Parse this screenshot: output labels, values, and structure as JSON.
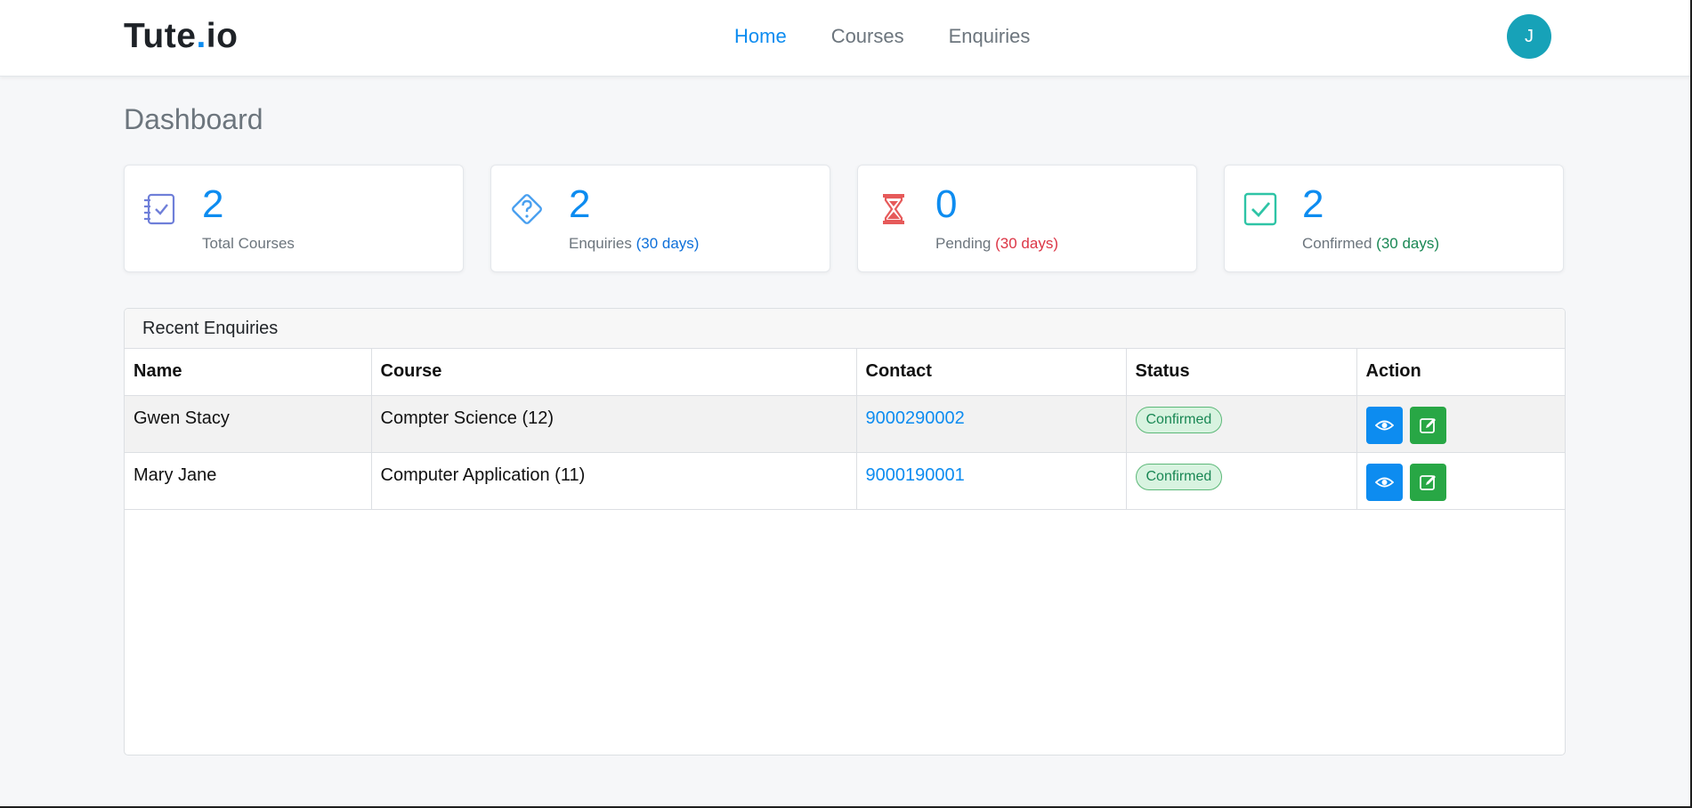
{
  "brand": {
    "name": "Tute",
    "dot": ".",
    "suffix": "io"
  },
  "nav": {
    "links": [
      {
        "label": "Home",
        "active": true
      },
      {
        "label": "Courses",
        "active": false
      },
      {
        "label": "Enquiries",
        "active": false
      }
    ],
    "avatar_initial": "J"
  },
  "page": {
    "title": "Dashboard"
  },
  "cards": [
    {
      "icon": "checklist-icon",
      "value": "2",
      "label": "Total Courses",
      "sub": "",
      "color": "#6f7fd9"
    },
    {
      "icon": "question-diamond-icon",
      "value": "2",
      "label": "Enquiries",
      "sub": "(30 days)",
      "color": "#4aa0f0"
    },
    {
      "icon": "hourglass-icon",
      "value": "0",
      "label": "Pending",
      "sub": "(30 days)",
      "color": "#e65a5a"
    },
    {
      "icon": "check-square-icon",
      "value": "2",
      "label": "Confirmed",
      "sub": "(30 days)",
      "color": "#2ec4a6"
    }
  ],
  "recent": {
    "title": "Recent Enquiries",
    "columns": [
      "Name",
      "Course",
      "Contact",
      "Status",
      "Action"
    ],
    "rows": [
      {
        "name": "Gwen Stacy",
        "course": "Compter Science (12)",
        "contact": "9000290002",
        "status": "Confirmed"
      },
      {
        "name": "Mary Jane",
        "course": "Computer Application (11)",
        "contact": "9000190001",
        "status": "Confirmed"
      }
    ]
  },
  "colors": {
    "accent": "#0d8cf0",
    "success": "#28a745",
    "avatar": "#17a2b8"
  }
}
